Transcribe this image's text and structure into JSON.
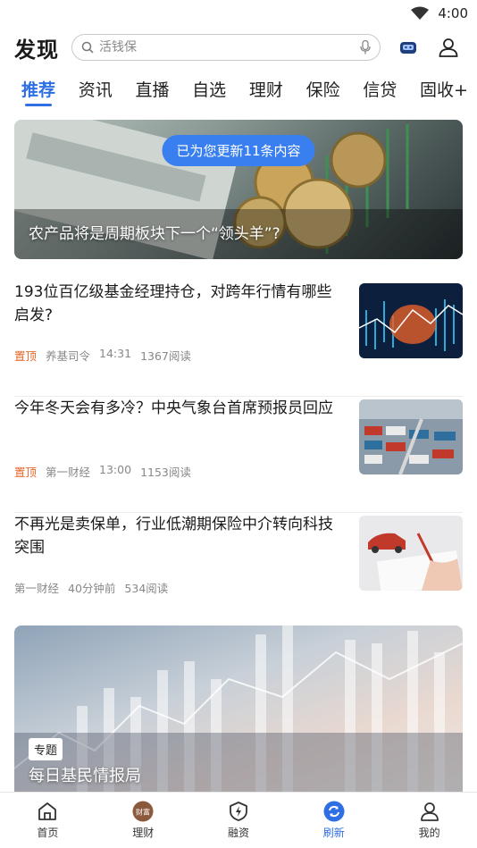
{
  "status": {
    "time": "4:00"
  },
  "header": {
    "title": "发现",
    "search_placeholder": "活钱保"
  },
  "tabs": [
    {
      "label": "推荐",
      "active": true
    },
    {
      "label": "资讯"
    },
    {
      "label": "直播"
    },
    {
      "label": "自选"
    },
    {
      "label": "理财"
    },
    {
      "label": "保险"
    },
    {
      "label": "信贷"
    },
    {
      "label": "固收+"
    }
  ],
  "banner": {
    "toast": "已为您更新11条内容",
    "caption": "农产品将是周期板块下一个“领头羊”?"
  },
  "news": [
    {
      "title": "193位百亿级基金经理持仓，对跨年行情有哪些启发?",
      "pin": "置顶",
      "source": "养基司令",
      "time": "14:31",
      "reads": "1367阅读"
    },
    {
      "title": "今年冬天会有多冷？中央气象台首席预报员回应",
      "pin": "置顶",
      "source": "第一财经",
      "time": "13:00",
      "reads": "1153阅读"
    },
    {
      "title": "不再光是卖保单，行业低潮期保险中介转向科技突围",
      "pin": "",
      "source": "第一财经",
      "time": "40分钟前",
      "reads": "534阅读"
    }
  ],
  "special": {
    "badge": "专题",
    "title": "每日基民情报局"
  },
  "bottom_nav": [
    {
      "label": "首页",
      "icon": "home-icon"
    },
    {
      "label": "理财",
      "icon": "wealth-icon",
      "icon_text": "财富"
    },
    {
      "label": "融资",
      "icon": "lightning-shield-icon"
    },
    {
      "label": "刷新",
      "icon": "refresh-icon",
      "active": true
    },
    {
      "label": "我的",
      "icon": "profile-icon"
    }
  ],
  "colors": {
    "accent": "#2f6fe4",
    "pin": "#e6672b"
  }
}
